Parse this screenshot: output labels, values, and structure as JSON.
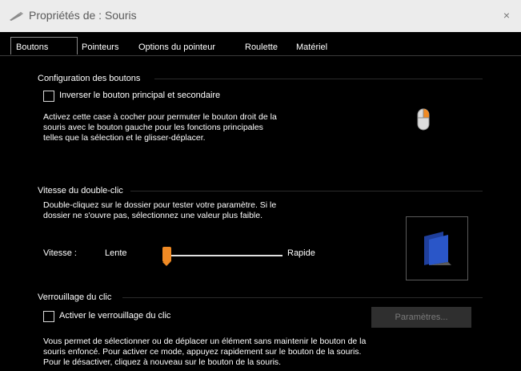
{
  "window": {
    "title": "Propriétés de : Souris",
    "close_label": "×"
  },
  "tabs": [
    {
      "label": "Boutons",
      "active": true
    },
    {
      "label": "Pointeurs"
    },
    {
      "label": "Options du pointeur"
    },
    {
      "label": "Roulette"
    },
    {
      "label": "Matériel"
    }
  ],
  "buttons_config": {
    "title": "Configuration des boutons",
    "swap_label": "Inverser le bouton principal et secondaire",
    "swap_checked": false,
    "description": [
      "Activez cette case à cocher pour permuter le bouton droit de la",
      "souris avec le bouton gauche pour les fonctions principales",
      "telles que la sélection et le glisser-déplacer."
    ]
  },
  "double_click": {
    "title": "Vitesse du double-clic",
    "description": [
      "Double-cliquez sur le dossier pour tester votre paramètre. Si le",
      "dossier ne s'ouvre pas, sélectionnez une valeur plus faible."
    ],
    "speed_label": "Vitesse :",
    "slow_label": "Lente",
    "fast_label": "Rapide",
    "speed_fraction": 0.0
  },
  "click_lock": {
    "title": "Verrouillage du clic",
    "enable_label": "Activer le verrouillage du clic",
    "enable_checked": false,
    "settings_button": "Paramètres...",
    "description": [
      "Vous permet de sélectionner ou de déplacer un élément sans maintenir le bouton de la",
      "souris enfoncé. Pour activer ce mode, appuyez rapidement sur le bouton de la souris.",
      "Pour le désactiver, cliquez à nouveau sur le bouton de la souris."
    ]
  },
  "colors": {
    "accent": "#f08a24",
    "folder": "#1f3f9c",
    "background": "#000000",
    "titlebar": "#ececec"
  }
}
